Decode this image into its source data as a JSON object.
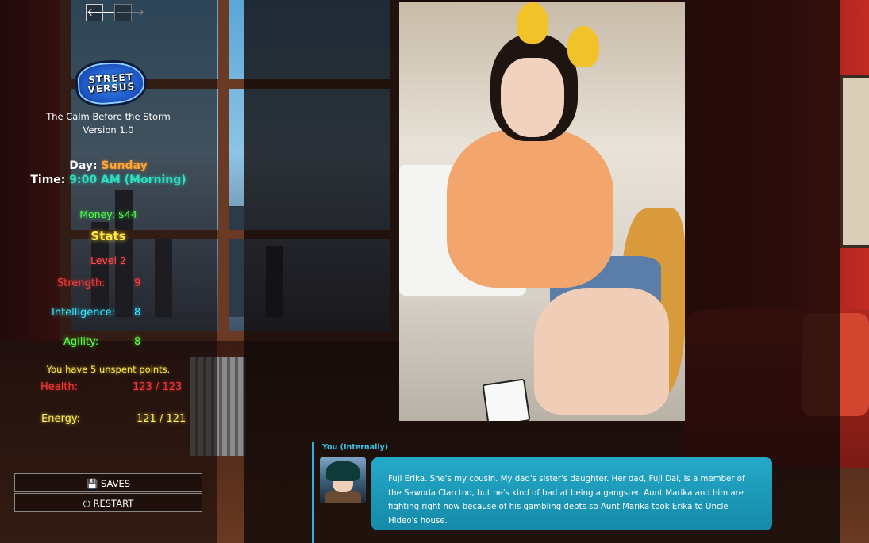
{
  "nav": {
    "back_icon": "arrow-left-icon",
    "back_glyph": "🡐",
    "forward_icon": "arrow-right-icon",
    "forward_glyph": "🡒"
  },
  "logo": {
    "line1": "STREET",
    "line2": "VERSUS"
  },
  "game": {
    "title": "The Calm Before the Storm",
    "version": "Version 1.0"
  },
  "status": {
    "day_label": "Day:",
    "day_value": "Sunday",
    "time_label": "Time:",
    "time_value": "9:00 AM (Morning)",
    "money": "Money: $44"
  },
  "stats": {
    "header": "Stats",
    "level": "Level 2",
    "strength_label": "Strength:",
    "strength_value": "9",
    "intelligence_label": "Intelligence:",
    "intelligence_value": "8",
    "agility_label": "Agility:",
    "agility_value": "8",
    "unspent": "You have 5 unspent points.",
    "health_label": "Health:",
    "health_value": "123 / 123",
    "energy_label": "Energy:",
    "energy_value": "121 / 121"
  },
  "menu": {
    "saves_label": "SAVES",
    "saves_icon": "floppy-disk-icon",
    "saves_glyph": "💾",
    "restart_label": "RESTART",
    "restart_icon": "power-icon",
    "restart_glyph": "⏻"
  },
  "dialogue": {
    "speaker": "You (Internally)",
    "text": "Fuji Erika. She's my cousin. My dad's sister's daughter. Her dad, Fuji Dai, is a member of the Sawoda Clan too, but he's kind of bad at being a gangster. Aunt Marika and him are fighting right now because of his gambling debts so Aunt Marika took Erika to Uncle Hideo's house."
  },
  "colors": {
    "day": "#ffa534",
    "time": "#2ee0c0",
    "money": "#4cff4c",
    "stats": "#ffe94a",
    "strength": "#ff3a3a",
    "intelligence": "#3ae6ff",
    "agility": "#5cff4a",
    "health": "#ff3a3a",
    "energy": "#ffef5a",
    "bubble": "#1b9ab8"
  }
}
